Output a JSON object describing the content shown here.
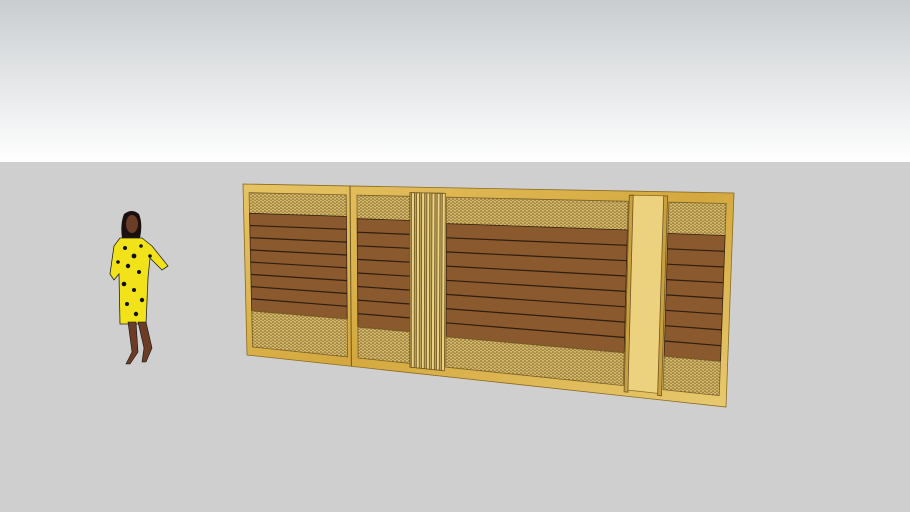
{
  "scene": {
    "subject": "gate-model",
    "colors": {
      "sky_top": "#c9cdd0",
      "sky_bottom": "#ffffff",
      "ground": "#cfcfcf",
      "gold_frame": "#d9b24a",
      "gold_light": "#ecd27e",
      "wood": "#8a5a2e",
      "wood_line": "#2e1d10",
      "mesh": "#c9a85a",
      "dress": "#f2e21a",
      "skin": "#6b3d26"
    }
  }
}
